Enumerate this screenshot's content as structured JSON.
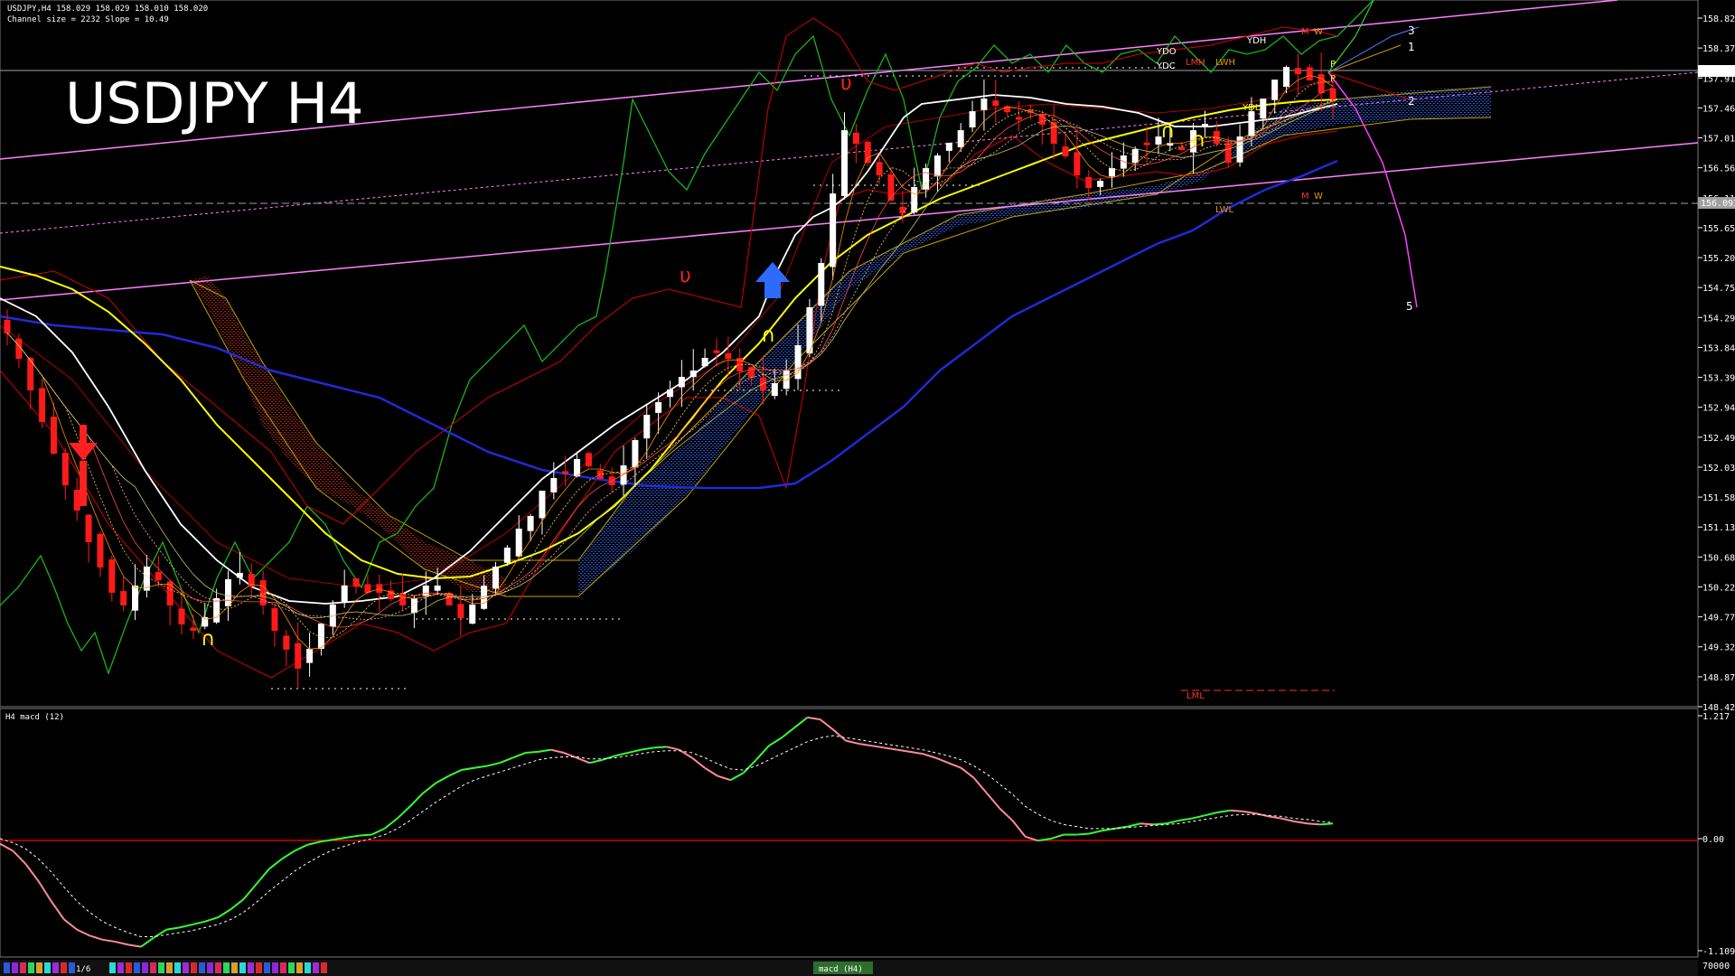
{
  "header": {
    "symbol_line": "USDJPY,H4  158.029 158.029 158.010 158.020",
    "channel_line": "Channel size = 2232 Slope = 10.49"
  },
  "title": "USDJPY H4",
  "subwindow_label": "H4  macd (12)",
  "bottom_tabs": {
    "page": "1/6",
    "indicator_tab": "macd (H4)"
  },
  "colors": {
    "background": "#000000",
    "bull_candle": "#ffffff",
    "bear_candle": "#ff1a1a",
    "ema_white": "#ffffff",
    "ema_yellow": "#ffff00",
    "ema_blue": "#1f2bd8",
    "bollinger": "#d40000",
    "chikou": "#19b319",
    "kumo_bull": "#2046c8",
    "kumo_bear": "#a51a10",
    "channel": "#ff80ff",
    "macd_up": "#33ff33",
    "macd_down": "#ff8a9a",
    "zero_line": "#ff0000"
  },
  "chart_data": [
    {
      "type": "candlestick",
      "title": "USDJPY H4",
      "ylim": [
        148.42,
        159.28
      ],
      "price_ticks": [
        "158.820",
        "158.370",
        "157.910",
        "157.460",
        "157.010",
        "156.560",
        "156.110",
        "155.650",
        "155.200",
        "154.750",
        "154.290",
        "153.840",
        "153.390",
        "152.940",
        "152.490",
        "152.030",
        "151.580",
        "151.130",
        "150.680",
        "150.220",
        "149.770",
        "149.320",
        "148.870",
        "148.420"
      ],
      "current_price": "158.020",
      "dashed_level": "156.093",
      "close_path": [
        154.3,
        153.9,
        153.4,
        152.9,
        152.4,
        151.9,
        151.5,
        151.0,
        150.6,
        150.2,
        150.0,
        150.3,
        150.6,
        150.4,
        150.0,
        149.7,
        149.6,
        149.8,
        150.1,
        150.4,
        150.5,
        150.3,
        150.0,
        149.6,
        149.3,
        149.0,
        149.3,
        149.7,
        150.0,
        150.3,
        150.3,
        150.2,
        150.2,
        150.1,
        150.0,
        150.1,
        150.3,
        150.3,
        150.0,
        149.8,
        150.0,
        150.3,
        150.6,
        150.9,
        151.2,
        151.4,
        151.8,
        152.0,
        152.1,
        152.3,
        152.2,
        152.0,
        151.9,
        152.2,
        152.6,
        153.0,
        153.2,
        153.4,
        153.6,
        153.7,
        153.9,
        154.0,
        153.9,
        153.7,
        153.6,
        153.4,
        153.5,
        153.7,
        154.1,
        154.7,
        155.4,
        156.5,
        157.5,
        157.3,
        157.0,
        156.8,
        156.4,
        156.2,
        156.6,
        156.9,
        157.1,
        157.3,
        157.5,
        157.8,
        158.0,
        157.9,
        157.8,
        157.7,
        157.8,
        157.6,
        157.3,
        157.1,
        156.8,
        156.6,
        156.7,
        156.9,
        157.1,
        157.2,
        157.3,
        157.4,
        157.3,
        157.2,
        157.5,
        157.6,
        157.3,
        157.0,
        157.4,
        157.8,
        158.0,
        158.3,
        158.5,
        158.4,
        158.3,
        158.1,
        158.0
      ],
      "annotations": [
        "YDO",
        "YDC",
        "YDH",
        "YDL",
        "LWH",
        "LWL",
        "LMH",
        "LML",
        "M",
        "W",
        "1",
        "2",
        "3",
        "5"
      ]
    },
    {
      "type": "line",
      "title": "H4  macd (12)",
      "ylim": [
        -1.109,
        1.217
      ],
      "y_ticks": [
        "1.217",
        "0.00",
        "-1.109"
      ],
      "volume_label": "70000",
      "series": [
        {
          "values": [
            -0.05,
            -0.12,
            -0.25,
            -0.42,
            -0.62,
            -0.8,
            -0.9,
            -0.96,
            -1.0,
            -1.02,
            -1.05,
            -1.07,
            -0.98,
            -0.9,
            -0.88,
            -0.85,
            -0.82,
            -0.78,
            -0.7,
            -0.6,
            -0.45,
            -0.3,
            -0.2,
            -0.12,
            -0.06,
            -0.03,
            -0.01,
            0.01,
            0.03,
            0.04,
            0.1,
            0.2,
            0.32,
            0.45,
            0.55,
            0.62,
            0.68,
            0.7,
            0.72,
            0.75,
            0.8,
            0.85,
            0.86,
            0.88,
            0.85,
            0.8,
            0.75,
            0.78,
            0.82,
            0.85,
            0.88,
            0.9,
            0.91,
            0.88,
            0.8,
            0.7,
            0.62,
            0.58,
            0.65,
            0.78,
            0.92,
            1.0,
            1.1,
            1.2,
            1.18,
            1.08,
            0.97,
            0.94,
            0.92,
            0.9,
            0.88,
            0.86,
            0.84,
            0.8,
            0.75,
            0.7,
            0.6,
            0.45,
            0.3,
            0.18,
            0.02,
            -0.02,
            0.0,
            0.04,
            0.04,
            0.05,
            0.08,
            0.1,
            0.12,
            0.15,
            0.14,
            0.15,
            0.18,
            0.2,
            0.23,
            0.26,
            0.28,
            0.27,
            0.25,
            0.22,
            0.2,
            0.17,
            0.15,
            0.14,
            0.15
          ]
        },
        {
          "values": [
            0.0,
            -0.04,
            -0.1,
            -0.2,
            -0.33,
            -0.48,
            -0.62,
            -0.73,
            -0.82,
            -0.88,
            -0.93,
            -0.97,
            -0.97,
            -0.95,
            -0.93,
            -0.91,
            -0.88,
            -0.85,
            -0.8,
            -0.73,
            -0.63,
            -0.52,
            -0.42,
            -0.32,
            -0.24,
            -0.17,
            -0.11,
            -0.07,
            -0.03,
            0.0,
            0.04,
            0.1,
            0.18,
            0.27,
            0.36,
            0.44,
            0.52,
            0.58,
            0.62,
            0.66,
            0.7,
            0.74,
            0.78,
            0.8,
            0.81,
            0.81,
            0.79,
            0.79,
            0.8,
            0.82,
            0.84,
            0.86,
            0.87,
            0.87,
            0.85,
            0.8,
            0.74,
            0.69,
            0.68,
            0.72,
            0.78,
            0.84,
            0.9,
            0.96,
            1.0,
            1.02,
            1.0,
            0.98,
            0.96,
            0.94,
            0.92,
            0.9,
            0.88,
            0.85,
            0.82,
            0.78,
            0.72,
            0.64,
            0.54,
            0.44,
            0.32,
            0.24,
            0.18,
            0.14,
            0.12,
            0.1,
            0.1,
            0.1,
            0.11,
            0.12,
            0.13,
            0.14,
            0.15,
            0.17,
            0.19,
            0.21,
            0.23,
            0.24,
            0.24,
            0.23,
            0.22,
            0.2,
            0.19,
            0.17,
            0.16
          ]
        }
      ]
    }
  ]
}
